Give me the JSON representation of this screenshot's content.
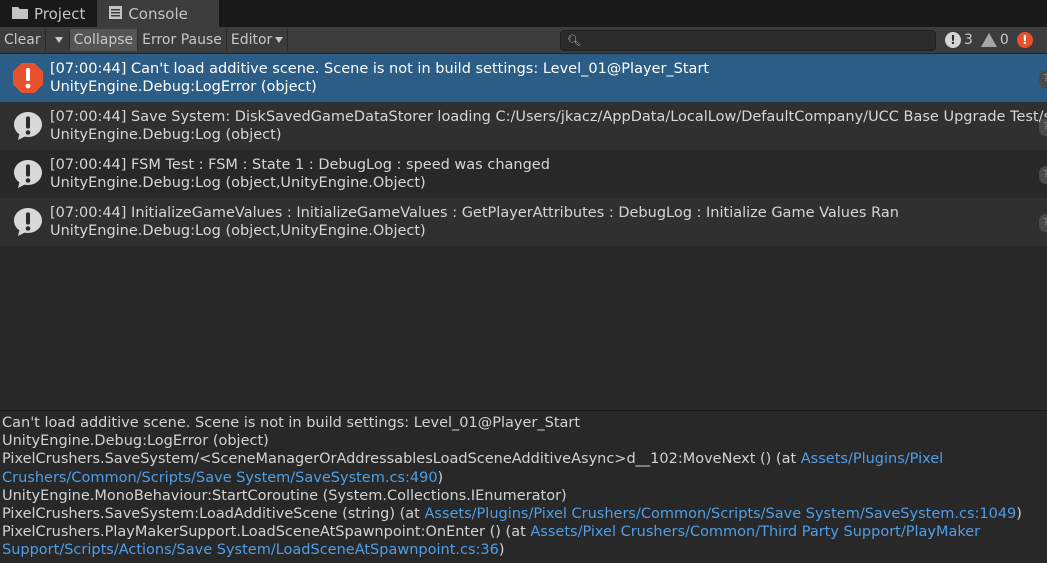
{
  "tabs": [
    {
      "label": "Project",
      "icon": "folder-icon"
    },
    {
      "label": "Console",
      "icon": "console-icon"
    }
  ],
  "toolbar": {
    "clear_label": "Clear",
    "collapse_label": "Collapse",
    "error_pause_label": "Error Pause",
    "editor_label": "Editor",
    "search_placeholder": "",
    "log_count": "3",
    "warning_count": "0",
    "error_icon": "!"
  },
  "logs": [
    {
      "line1": "[07:00:44] Can't load additive scene. Scene is not in build settings: Level_01@Player_Start",
      "line2": "UnityEngine.Debug:LogError (object)",
      "type": "error"
    },
    {
      "line1": "[07:00:44] Save System: DiskSavedGameDataStorer loading C:/Users/jkacz/AppData/LocalLow/DefaultCompany/UCC Base Upgrade Test/s",
      "line2": "UnityEngine.Debug:Log (object)",
      "type": "info"
    },
    {
      "line1": "[07:00:44] FSM Test : FSM : State 1 : DebugLog : speed was changed",
      "line2": "UnityEngine.Debug:Log (object,UnityEngine.Object)",
      "type": "info"
    },
    {
      "line1": "[07:00:44] InitializeGameValues : InitializeGameValues : GetPlayerAttributes : DebugLog : Initialize Game Values Ran",
      "line2": "UnityEngine.Debug:Log (object,UnityEngine.Object)",
      "type": "info"
    }
  ],
  "detail": {
    "l1": "Can't load additive scene. Scene is not in build settings: Level_01@Player_Start",
    "l2": "UnityEngine.Debug:LogError (object)",
    "l3_pre": "PixelCrushers.SaveSystem/<SceneManagerOrAddressablesLoadSceneAdditiveAsync>d__102:MoveNext () (at ",
    "l3_link": "Assets/Plugins/Pixel Crushers/Common/Scripts/Save System/SaveSystem.cs:490",
    "l3_post": ")",
    "l4": "UnityEngine.MonoBehaviour:StartCoroutine (System.Collections.IEnumerator)",
    "l5_pre": "PixelCrushers.SaveSystem:LoadAdditiveScene (string) (at ",
    "l5_link": "Assets/Plugins/Pixel Crushers/Common/Scripts/Save System/SaveSystem.cs:1049",
    "l5_post": ")",
    "l6_pre": "PixelCrushers.PlayMakerSupport.LoadSceneAtSpawnpoint:OnEnter () (at ",
    "l6_link": "Assets/Pixel Crushers/Common/Third Party Support/PlayMaker Support/Scripts/Actions/Save System/LoadSceneAtSpawnpoint.cs:36",
    "l6_post": ")"
  }
}
